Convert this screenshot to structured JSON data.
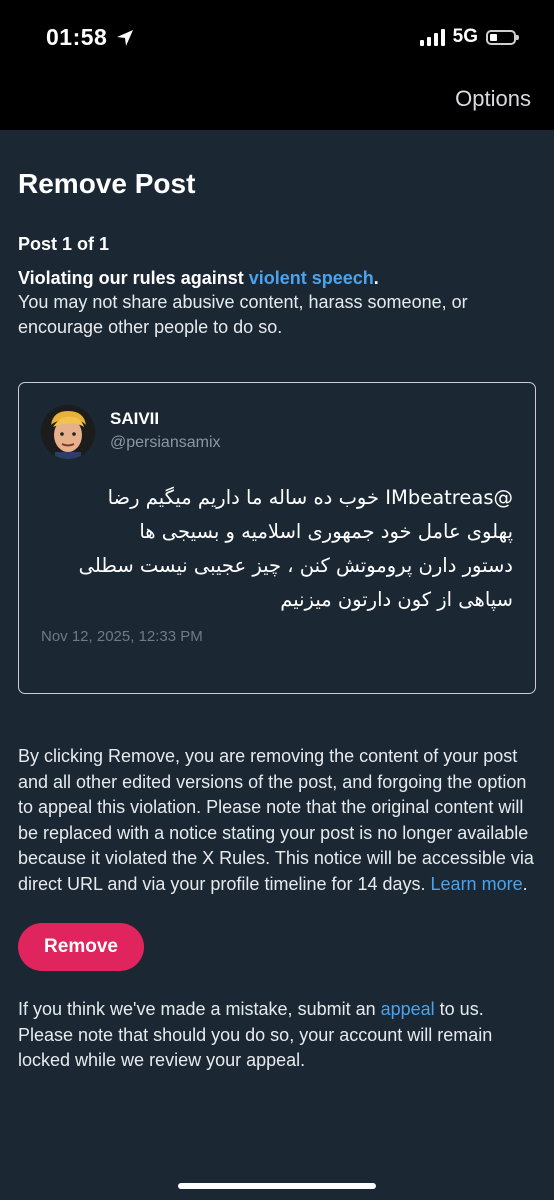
{
  "status_bar": {
    "time": "01:58",
    "network": "5G",
    "icons": [
      "location-arrow-icon",
      "signal-bars-icon",
      "battery-icon"
    ]
  },
  "nav": {
    "options_label": "Options"
  },
  "page": {
    "title": "Remove Post",
    "post_count": "Post 1 of 1",
    "violation_prefix": "Violating our rules against ",
    "violation_link": "violent speech",
    "violation_suffix": ".",
    "violation_description": "You may not share abusive content, harass someone, or encourage other people to do so."
  },
  "post": {
    "author_name": "SAIVII",
    "author_handle": "@persiansamix",
    "text_lines": [
      "@IMbeatreas خوب ده ساله ما داریم میگیم رضا",
      "پهلوی عامل خود جمهوری اسلامیه و بسیجی ها",
      "دستور دارن پروموتش کنن ، چیز عجیبی نیست سطلی",
      "سپاهی از کون دارتون میزنیم"
    ],
    "date": "Nov 12, 2025, 12:33 PM"
  },
  "notice": {
    "text": "By clicking Remove, you are removing the content of your post and all other edited versions of the post, and forgoing the option to appeal this violation. Please note that the original content will be replaced with a notice stating your post is no longer available because it violated the X Rules. This notice will be accessible via direct URL and via your profile timeline for 14 days. ",
    "learn_more": "Learn more",
    "learn_more_suffix": "."
  },
  "actions": {
    "remove_label": "Remove"
  },
  "appeal": {
    "prefix": "If you think we've made a mistake, submit an ",
    "link": "appeal",
    "suffix": " to us. Please note that should you do so, your account will remain locked while we review your appeal."
  },
  "colors": {
    "background": "#1b2834",
    "link": "#4aa3ec",
    "remove_button": "#e0245e"
  }
}
